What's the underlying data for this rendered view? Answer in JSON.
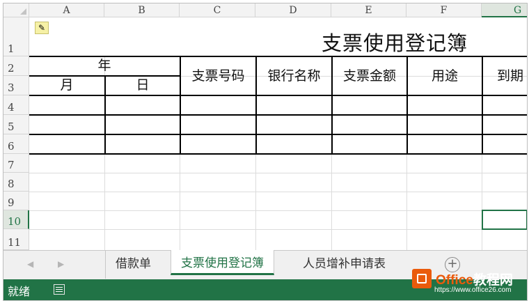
{
  "columns": [
    "A",
    "B",
    "C",
    "D",
    "E",
    "F",
    "G"
  ],
  "rows": [
    "1",
    "2",
    "3",
    "4",
    "5",
    "6",
    "7",
    "8",
    "9",
    "10",
    "11"
  ],
  "selected_column": "G",
  "selected_row": "10",
  "sheet": {
    "title": "支票使用登记簿",
    "headers": {
      "year": "年",
      "month": "月",
      "day": "日",
      "check_number": "支票号码",
      "bank_name": "银行名称",
      "check_amount": "支票金额",
      "purpose": "用途",
      "due_date": "到期"
    }
  },
  "tabs": {
    "prev_arrow": "◀",
    "next_arrow": "▶",
    "items": [
      "借款单",
      "支票使用登记簿",
      "人员增补申请表"
    ],
    "active": "支票使用登记簿",
    "add_label": "+"
  },
  "status_bar": {
    "ready_text": "就绪"
  },
  "watermark": {
    "brand_part1": "Office",
    "brand_part2": "教程网",
    "url": "https://www.office26.com"
  },
  "colors": {
    "accent": "#217346",
    "watermark_orange": "#ea5b0c"
  }
}
